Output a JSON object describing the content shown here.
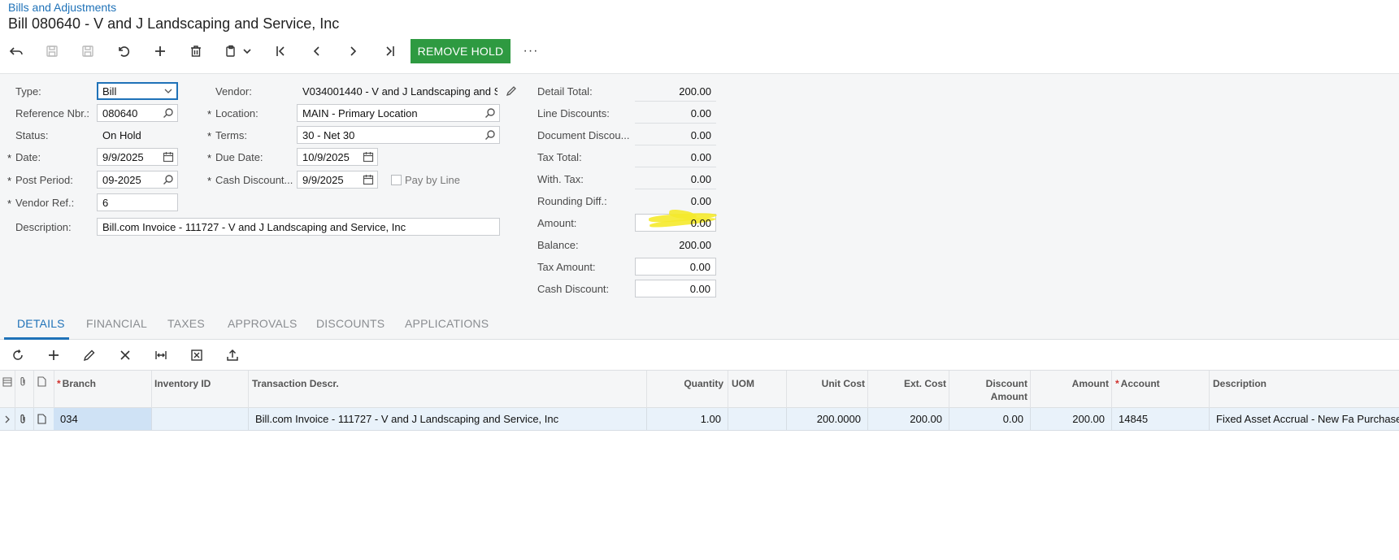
{
  "header": {
    "breadcrumb": "Bills and Adjustments",
    "title": "Bill 080640 - V and J Landscaping and Service, Inc"
  },
  "toolbar": {
    "remove_hold_label": "REMOVE HOLD",
    "icons": [
      "undo-back-icon",
      "save-icon",
      "save-close-icon",
      "cancel-icon",
      "add-icon",
      "delete-icon",
      "copy-paste-icon",
      "first-icon",
      "prev-icon",
      "next-icon",
      "last-icon",
      "more-icon"
    ],
    "more_label": "···"
  },
  "form": {
    "type_label": "Type:",
    "type_value": "Bill",
    "refnbr_label": "Reference Nbr.:",
    "refnbr_value": "080640",
    "status_label": "Status:",
    "status_value": "On Hold",
    "date_label": "Date:",
    "date_value": "9/9/2025",
    "postperiod_label": "Post Period:",
    "postperiod_value": "09-2025",
    "vendorref_label": "Vendor Ref.:",
    "vendorref_value": "6",
    "description_label": "Description:",
    "description_value": "Bill.com Invoice - 111727 - V and J Landscaping and Service, Inc",
    "vendor_label": "Vendor:",
    "vendor_value": "V034001440 - V and J Landscaping and S",
    "location_label": "Location:",
    "location_value": "MAIN - Primary Location",
    "terms_label": "Terms:",
    "terms_value": "30 - Net 30",
    "duedate_label": "Due Date:",
    "duedate_value": "10/9/2025",
    "cashdiscount_label": "Cash Discount...",
    "cashdiscount_value": "9/9/2025",
    "paybyline_label": "Pay by Line",
    "required_mark": "*"
  },
  "summary": {
    "detail_total_label": "Detail Total:",
    "detail_total": "200.00",
    "line_discounts_label": "Line Discounts:",
    "line_discounts": "0.00",
    "document_discount_label": "Document Discou...",
    "document_discount": "0.00",
    "tax_total_label": "Tax Total:",
    "tax_total": "0.00",
    "with_tax_label": "With. Tax:",
    "with_tax": "0.00",
    "rounding_label": "Rounding Diff.:",
    "rounding": "0.00",
    "amount_label": "Amount:",
    "amount": "0.00",
    "balance_label": "Balance:",
    "balance": "200.00",
    "tax_amount_label": "Tax Amount:",
    "tax_amount": "0.00",
    "cash_discount_label": "Cash Discount:",
    "cash_discount": "0.00",
    "highlight_color": "#f5ea2c"
  },
  "tabs": [
    "DETAILS",
    "FINANCIAL",
    "TAXES",
    "APPROVALS",
    "DISCOUNTS",
    "APPLICATIONS"
  ],
  "grid": {
    "toolbar_icons": [
      "refresh-icon",
      "add-row-icon",
      "edit-icon",
      "delete-row-icon",
      "fit-columns-icon",
      "export-excel-icon",
      "upload-icon"
    ],
    "columns": {
      "branch": "Branch",
      "inventory": "Inventory ID",
      "trandesc": "Transaction Descr.",
      "quantity": "Quantity",
      "uom": "UOM",
      "unitcost": "Unit Cost",
      "extcost": "Ext. Cost",
      "discount_l1": "Discount",
      "discount_l2": "Amount",
      "amount": "Amount",
      "account": "Account",
      "description": "Description"
    },
    "rows": [
      {
        "branch": "034",
        "inventory": "",
        "trandesc": "Bill.com Invoice - 111727 - V and J Landscaping and Service, Inc",
        "quantity": "1.00",
        "uom": "",
        "unitcost": "200.0000",
        "extcost": "200.00",
        "discount": "0.00",
        "amount": "200.00",
        "account": "14845",
        "description": "Fixed Asset Accrual - New Fa Purchase"
      }
    ]
  },
  "colors": {
    "accent": "#1f72b8",
    "remove_hold_bg": "#2e9a41",
    "required": "#d0312d"
  }
}
